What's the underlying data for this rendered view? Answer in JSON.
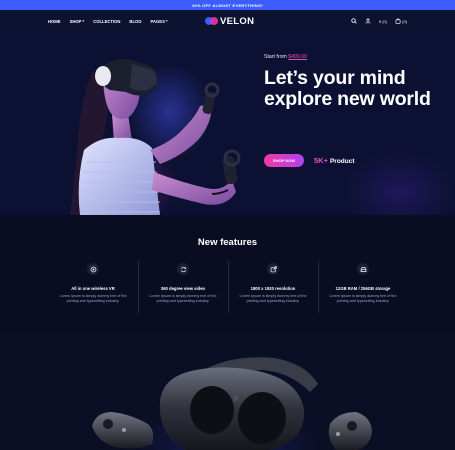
{
  "promo": {
    "text": "40% OFF ALMOST EVERYTHING!"
  },
  "nav": {
    "items": [
      {
        "label": "HOME"
      },
      {
        "label": "SHOP",
        "caret": "▾"
      },
      {
        "label": "COLLECTION"
      },
      {
        "label": "BLOG"
      },
      {
        "label": "PAGES",
        "caret": "▾"
      }
    ]
  },
  "logo": {
    "text": "VELON"
  },
  "header_icons": {
    "search": "search-icon",
    "account": "user-icon",
    "currency": "€",
    "wishlist_count": "(0)",
    "cart": "cart-icon",
    "cart_count": "(0)"
  },
  "hero": {
    "start_from": "Start from",
    "price": "$499.00",
    "headline": "Let’s your mind explore new world",
    "cta": "SHOP NOW",
    "stat_number": "5K+",
    "stat_label": "Product"
  },
  "features": {
    "title": "New features",
    "items": [
      {
        "icon": "wifi-target-icon",
        "name": "All in one wireless VR",
        "desc": "Lorem Ipsum is simply dummy text of the printing and typesetting industry."
      },
      {
        "icon": "rotate-icon",
        "name": "360 degree view video",
        "desc": "Lorem Ipsum is simply dummy text of the printing and typesetting industry."
      },
      {
        "icon": "share-arrow-icon",
        "name": "1800 x 1920 resolution",
        "desc": "Lorem Ipsum is simply dummy text of the printing and typesetting industry."
      },
      {
        "icon": "storage-icon",
        "name": "12GB RAM / 256GB storage",
        "desc": "Lorem Ipsum is simply dummy text of the printing and typesetting industry."
      }
    ]
  },
  "colors": {
    "accent_blue": "#3d5cff",
    "accent_pink": "#e64bb3",
    "background": "#0b0f24"
  }
}
